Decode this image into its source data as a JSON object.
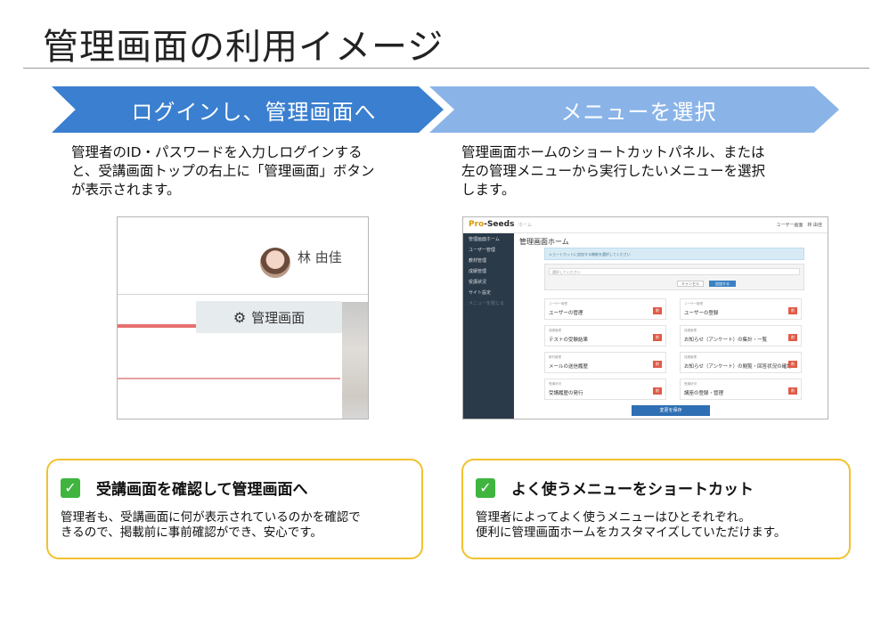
{
  "title": "管理画面の利用イメージ",
  "steps": [
    {
      "label": "ログインし、管理画面へ"
    },
    {
      "label": "メニューを選択"
    }
  ],
  "descriptions": [
    "管理者のID・パスワードを入力しログインする\nと、受講画面トップの右上に「管理画面」ボタン\nが表示されます。",
    "管理画面ホームのショートカットパネル、または\n左の管理メニューから実行したいメニューを選択\nします。"
  ],
  "login_screenshot": {
    "user_name": "林 由佳",
    "admin_button": "管理画面",
    "admin_icon": "gear-icon"
  },
  "admin_screenshot": {
    "logo": "Pro-Seeds",
    "breadcrumb": "ホーム",
    "topbar_right": "ユーザー画面　林 由佳",
    "heading": "管理画面ホーム",
    "info_text": "ショートカットに追加する機能を選択してください",
    "select_placeholder": "選択してください",
    "cancel_label": "キャンセル",
    "add_label": "追加する",
    "save_label": "変更を保存",
    "sidebar": [
      "管理画面ホーム",
      "ユーザー管理",
      "教材管理",
      "成績管理",
      "受講状況",
      "サイト設定",
      "メニューを閉じる"
    ],
    "cards": [
      {
        "category": "ユーザー管理",
        "label": "ユーザーの管理"
      },
      {
        "category": "ユーザー管理",
        "label": "ユーザーの登録"
      },
      {
        "category": "成績管理",
        "label": "テストの受験結果"
      },
      {
        "category": "成績管理",
        "label": "お知らせ（アンケート）の集計・一覧"
      },
      {
        "category": "教材管理",
        "label": "メールの送信履歴"
      },
      {
        "category": "成績管理",
        "label": "お知らせ（アンケート）の閲覧・回答状況の確認"
      },
      {
        "category": "受講状況",
        "label": "受講履歴の発行"
      },
      {
        "category": "受講状況",
        "label": "講座の登録・管理"
      }
    ],
    "delete_label": "削"
  },
  "features": [
    {
      "title": "受講画面を確認して管理画面へ",
      "text": "管理者も、受講画面に何が表示されているのかを確認で\nきるので、掲載前に事前確認ができ、安心です。"
    },
    {
      "title": "よく使うメニューをショートカット",
      "text": "管理者によってよく使うメニューはひとそれぞれ。\n便利に管理画面ホームをカスタマイズしていただけます。"
    }
  ],
  "colors": {
    "step1": "#3a7fd0",
    "step2": "#8ab4e8",
    "feature_border": "#f2c12e",
    "check": "#3fb540"
  }
}
